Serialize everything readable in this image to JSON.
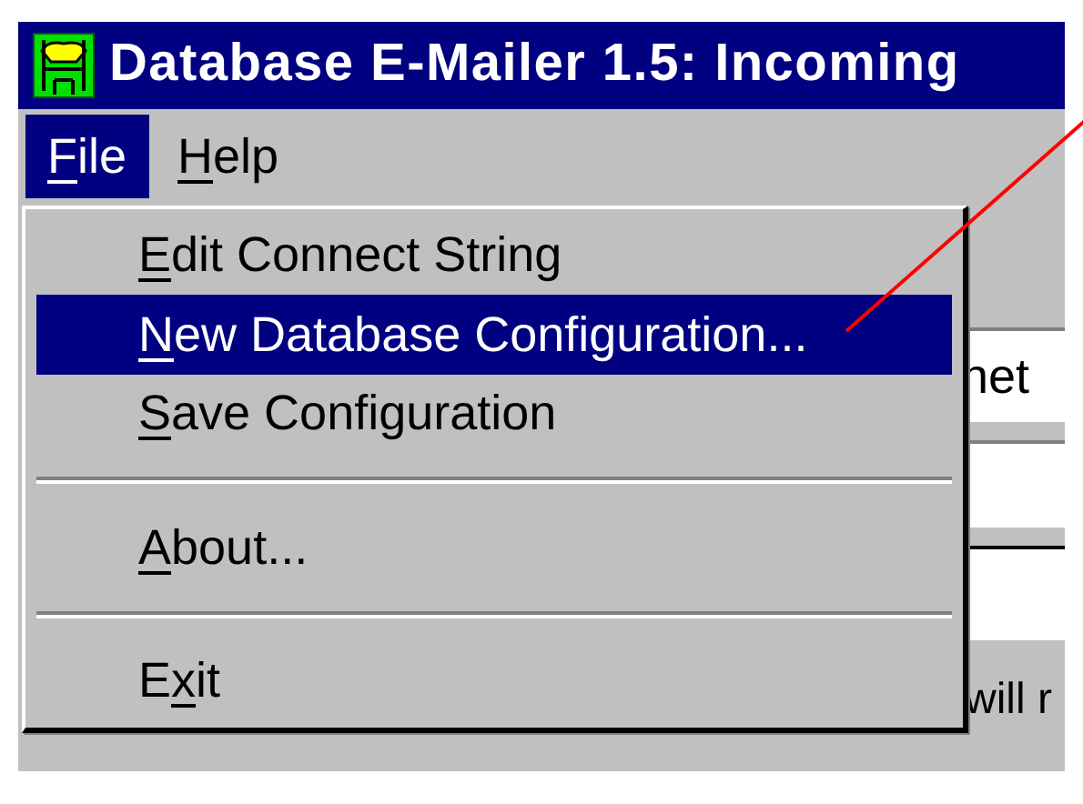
{
  "window": {
    "title": "Database E-Mailer 1.5: Incoming"
  },
  "menu_bar": [
    {
      "label": {
        "key": "F",
        "post": "ile"
      },
      "selected": true
    },
    {
      "label": {
        "key": "H",
        "post": "elp"
      },
      "selected": false
    }
  ],
  "file_menu": [
    {
      "kind": "item",
      "label": {
        "key": "E",
        "post": "dit Connect String"
      },
      "selected": false
    },
    {
      "kind": "item",
      "label": {
        "key": "N",
        "post": "ew Database Configuration..."
      },
      "selected": true
    },
    {
      "kind": "item",
      "label": {
        "key": "S",
        "post": "ave Configuration"
      },
      "selected": false
    },
    {
      "kind": "separator"
    },
    {
      "kind": "item",
      "label": {
        "key": "A",
        "post": "bout..."
      },
      "selected": false
    },
    {
      "kind": "separator"
    },
    {
      "kind": "item",
      "label": {
        "pre": "E",
        "key": "x",
        "post": "it"
      },
      "selected": false
    }
  ],
  "background": {
    "field_text": "net",
    "status_text": "will r"
  }
}
